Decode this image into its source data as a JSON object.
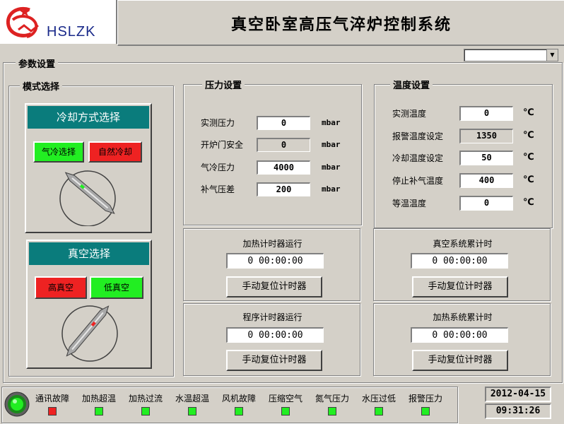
{
  "header": {
    "logo_text": "HSLZK",
    "title": "真空卧室高压气淬炉控制系统"
  },
  "params": {
    "legend": "参数设置",
    "combo_value": ""
  },
  "mode": {
    "legend": "模式选择",
    "cooling": {
      "title": "冷却方式选择",
      "btn_gas": "气冷选择",
      "btn_natural": "自然冷却"
    },
    "vacuum": {
      "title": "真空选择",
      "btn_high": "高真空",
      "btn_low": "低真空"
    }
  },
  "pressure": {
    "legend": "压力设置",
    "rows": [
      {
        "label": "实测压力",
        "value": "0",
        "unit": "mbar",
        "readonly": false
      },
      {
        "label": "开炉门安全",
        "value": "0",
        "unit": "mbar",
        "readonly": true
      },
      {
        "label": "气冷压力",
        "value": "4000",
        "unit": "mbar",
        "readonly": false
      },
      {
        "label": "补气压差",
        "value": "200",
        "unit": "mbar",
        "readonly": false
      }
    ]
  },
  "temperature": {
    "legend": "温度设置",
    "rows": [
      {
        "label": "实测温度",
        "value": "0",
        "unit": "℃"
      },
      {
        "label": "报警温度设定",
        "value": "1350",
        "unit": "℃"
      },
      {
        "label": "冷却温度设定",
        "value": "50",
        "unit": "℃"
      },
      {
        "label": "停止补气温度",
        "value": "400",
        "unit": "℃"
      },
      {
        "label": "等温温度",
        "value": "0",
        "unit": "℃"
      }
    ]
  },
  "timers": {
    "heat_run": {
      "title": "加热计时器运行",
      "value": "0 00:00:00",
      "button": "手动复位计时器"
    },
    "vacuum_total": {
      "title": "真空系统累计时",
      "value": "0 00:00:00",
      "button": "手动复位计时器"
    },
    "program_run": {
      "title": "程序计时器运行",
      "value": "0 00:00:00",
      "button": "手动复位计时器"
    },
    "heat_total": {
      "title": "加热系统累计时",
      "value": "0 00:00:00",
      "button": "手动复位计时器"
    }
  },
  "alarms": [
    {
      "label": "通讯故障",
      "state": "red"
    },
    {
      "label": "加热超温",
      "state": "green"
    },
    {
      "label": "加热过流",
      "state": "green"
    },
    {
      "label": "水温超温",
      "state": "green"
    },
    {
      "label": "风机故障",
      "state": "green"
    },
    {
      "label": "压缩空气",
      "state": "green"
    },
    {
      "label": "氮气压力",
      "state": "green"
    },
    {
      "label": "水压过低",
      "state": "green"
    },
    {
      "label": "报警压力",
      "state": "green"
    }
  ],
  "status": {
    "date": "2012-04-15",
    "time": "09:31:26"
  },
  "colors": {
    "panel_bg": "#d4d0c8",
    "teal": "#0a7c7c",
    "on_green": "#22ee22",
    "alarm_red": "#ee2222",
    "logo_red": "#dd2222",
    "logo_blue": "#1a2a8a"
  }
}
